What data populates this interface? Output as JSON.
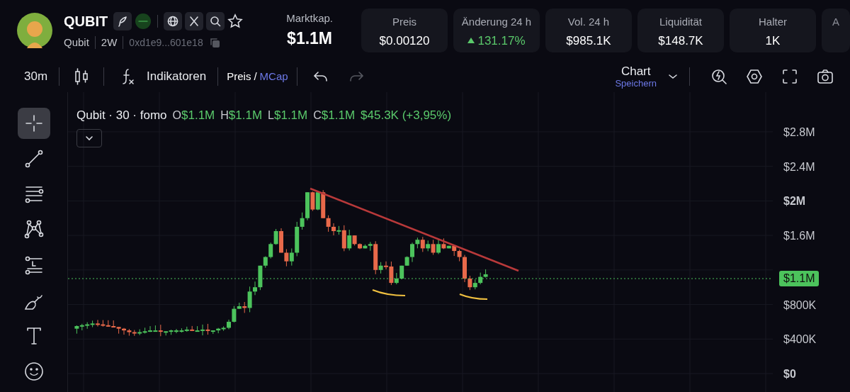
{
  "token": {
    "symbol": "QUBIT",
    "name": "Qubit",
    "age": "2W",
    "address": "0xd1e9...601e18",
    "favorite": false
  },
  "market_cap": {
    "label": "Marktkap.",
    "value": "$1.1M"
  },
  "stats": [
    {
      "label": "Preis",
      "value": "$0.00120",
      "rising": false
    },
    {
      "label": "Änderung 24 h",
      "value": "131.17%",
      "rising": true
    },
    {
      "label": "Vol. 24 h",
      "value": "$985.1K",
      "rising": false
    },
    {
      "label": "Liquidität",
      "value": "$148.7K",
      "rising": false
    },
    {
      "label": "Halter",
      "value": "1K",
      "rising": false
    },
    {
      "label": "A"
    }
  ],
  "toolbar": {
    "interval": "30m",
    "indicators": "Indikatoren",
    "price_mode": "Preis",
    "separator": "/",
    "mcap_mode": "MCap",
    "chart_title": "Chart",
    "chart_save": "Speichern"
  },
  "legend": {
    "title": "Qubit · 30 · fomo",
    "ohlc": [
      {
        "key": "O",
        "value": "$1.1M"
      },
      {
        "key": "H",
        "value": "$1.1M"
      },
      {
        "key": "L",
        "value": "$1.1M"
      },
      {
        "key": "C",
        "value": "$1.1M"
      }
    ],
    "change": "$45.3K (+3,95%)"
  },
  "tools": [
    {
      "kind": "crosshair",
      "selected": true
    },
    {
      "kind": "trendline",
      "selected": false
    },
    {
      "kind": "fib",
      "selected": false
    },
    {
      "kind": "pattern",
      "selected": false
    },
    {
      "kind": "measure",
      "selected": false
    },
    {
      "kind": "brush",
      "selected": false
    },
    {
      "kind": "text",
      "selected": false
    },
    {
      "kind": "emoji",
      "selected": false
    }
  ],
  "price_axis": [
    {
      "label": "$2.8M",
      "bold": false
    },
    {
      "label": "$2.4M",
      "bold": false
    },
    {
      "label": "$2M",
      "bold": true
    },
    {
      "label": "$1.6M",
      "bold": false
    },
    {
      "label": "$800K",
      "bold": false
    },
    {
      "label": "$400K",
      "bold": false
    },
    {
      "label": "$0",
      "bold": true
    }
  ],
  "current_price": "$1.1M"
}
